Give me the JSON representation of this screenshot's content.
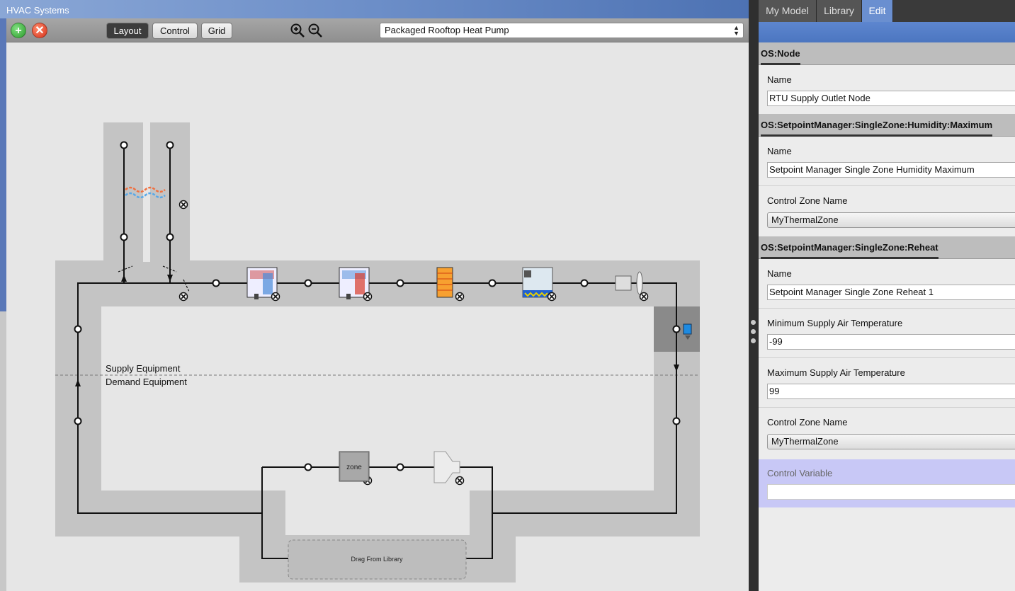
{
  "window": {
    "title": "HVAC Systems"
  },
  "toolbar": {
    "layout_label": "Layout",
    "control_label": "Control",
    "grid_label": "Grid",
    "system_selected": "Packaged Rooftop Heat Pump"
  },
  "diagram": {
    "supply_label": "Supply Equipment",
    "demand_label": "Demand Equipment",
    "zone_label": "zone",
    "drop_zone_label": "Drag From Library"
  },
  "tabs": [
    "My Model",
    "Library",
    "Edit"
  ],
  "inspector": {
    "node_header": "OS:Node",
    "node_name_label": "Name",
    "node_name_value": "RTU Supply Outlet Node",
    "humidity_header": "OS:SetpointManager:SingleZone:Humidity:Maximum",
    "humidity_name_label": "Name",
    "humidity_name_value": "Setpoint Manager Single Zone Humidity Maximum",
    "humidity_zone_label": "Control Zone Name",
    "humidity_zone_value": "MyThermalZone",
    "reheat_header": "OS:SetpointManager:SingleZone:Reheat",
    "reheat_name_label": "Name",
    "reheat_name_value": "Setpoint Manager Single Zone Reheat 1",
    "min_temp_label": "Minimum Supply Air Temperature",
    "min_temp_value": "-99",
    "max_temp_label": "Maximum Supply Air Temperature",
    "max_temp_value": "99",
    "reheat_zone_label": "Control Zone Name",
    "reheat_zone_value": "MyThermalZone",
    "control_variable_label": "Control Variable",
    "control_variable_value": ""
  },
  "colors": {
    "title_bar": "#6c8ec8",
    "edit_tab": "#6a8fd0",
    "control_variable_bg": "#c8c8f6",
    "loop_band": "#c4c4c4",
    "selected_node_band": "#8a8a8a"
  },
  "icons": [
    "add-icon",
    "remove-icon",
    "zoom-in-icon",
    "zoom-out-icon",
    "heat-exchanger-icon",
    "dx-cooling-coil-icon",
    "dx-heating-coil-icon",
    "electric-heating-coil-icon",
    "humidifier-icon",
    "fan-icon",
    "setpoint-manager-icon",
    "zone-icon",
    "air-terminal-icon",
    "remove-component-icon",
    "splitter-handle-icon"
  ]
}
